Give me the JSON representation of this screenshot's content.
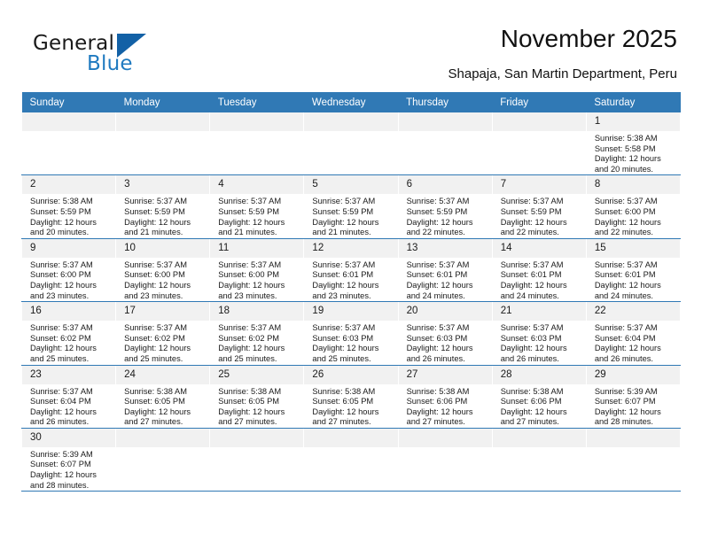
{
  "brand": {
    "name_part1": "General",
    "name_part2": "Blue",
    "triangle_color": "#1361a6",
    "blue_color": "#1f7ac0"
  },
  "header": {
    "title": "November 2025",
    "subtitle": "Shapaja, San Martin Department, Peru"
  },
  "theme": {
    "header_row_bg": "#3079b5",
    "header_row_text": "#ffffff",
    "daynum_bg": "#f1f1f1",
    "grid_line": "#3079b5"
  },
  "weekdays": [
    "Sunday",
    "Monday",
    "Tuesday",
    "Wednesday",
    "Thursday",
    "Friday",
    "Saturday"
  ],
  "weeks": [
    [
      {
        "day": "",
        "empty": true,
        "sunrise": "",
        "sunset": "",
        "daylight_line1": "",
        "daylight_line2": ""
      },
      {
        "day": "",
        "empty": true,
        "sunrise": "",
        "sunset": "",
        "daylight_line1": "",
        "daylight_line2": ""
      },
      {
        "day": "",
        "empty": true,
        "sunrise": "",
        "sunset": "",
        "daylight_line1": "",
        "daylight_line2": ""
      },
      {
        "day": "",
        "empty": true,
        "sunrise": "",
        "sunset": "",
        "daylight_line1": "",
        "daylight_line2": ""
      },
      {
        "day": "",
        "empty": true,
        "sunrise": "",
        "sunset": "",
        "daylight_line1": "",
        "daylight_line2": ""
      },
      {
        "day": "",
        "empty": true,
        "sunrise": "",
        "sunset": "",
        "daylight_line1": "",
        "daylight_line2": ""
      },
      {
        "day": "1",
        "empty": false,
        "sunrise": "Sunrise: 5:38 AM",
        "sunset": "Sunset: 5:58 PM",
        "daylight_line1": "Daylight: 12 hours",
        "daylight_line2": "and 20 minutes."
      }
    ],
    [
      {
        "day": "2",
        "empty": false,
        "sunrise": "Sunrise: 5:38 AM",
        "sunset": "Sunset: 5:59 PM",
        "daylight_line1": "Daylight: 12 hours",
        "daylight_line2": "and 20 minutes."
      },
      {
        "day": "3",
        "empty": false,
        "sunrise": "Sunrise: 5:37 AM",
        "sunset": "Sunset: 5:59 PM",
        "daylight_line1": "Daylight: 12 hours",
        "daylight_line2": "and 21 minutes."
      },
      {
        "day": "4",
        "empty": false,
        "sunrise": "Sunrise: 5:37 AM",
        "sunset": "Sunset: 5:59 PM",
        "daylight_line1": "Daylight: 12 hours",
        "daylight_line2": "and 21 minutes."
      },
      {
        "day": "5",
        "empty": false,
        "sunrise": "Sunrise: 5:37 AM",
        "sunset": "Sunset: 5:59 PM",
        "daylight_line1": "Daylight: 12 hours",
        "daylight_line2": "and 21 minutes."
      },
      {
        "day": "6",
        "empty": false,
        "sunrise": "Sunrise: 5:37 AM",
        "sunset": "Sunset: 5:59 PM",
        "daylight_line1": "Daylight: 12 hours",
        "daylight_line2": "and 22 minutes."
      },
      {
        "day": "7",
        "empty": false,
        "sunrise": "Sunrise: 5:37 AM",
        "sunset": "Sunset: 5:59 PM",
        "daylight_line1": "Daylight: 12 hours",
        "daylight_line2": "and 22 minutes."
      },
      {
        "day": "8",
        "empty": false,
        "sunrise": "Sunrise: 5:37 AM",
        "sunset": "Sunset: 6:00 PM",
        "daylight_line1": "Daylight: 12 hours",
        "daylight_line2": "and 22 minutes."
      }
    ],
    [
      {
        "day": "9",
        "empty": false,
        "sunrise": "Sunrise: 5:37 AM",
        "sunset": "Sunset: 6:00 PM",
        "daylight_line1": "Daylight: 12 hours",
        "daylight_line2": "and 23 minutes."
      },
      {
        "day": "10",
        "empty": false,
        "sunrise": "Sunrise: 5:37 AM",
        "sunset": "Sunset: 6:00 PM",
        "daylight_line1": "Daylight: 12 hours",
        "daylight_line2": "and 23 minutes."
      },
      {
        "day": "11",
        "empty": false,
        "sunrise": "Sunrise: 5:37 AM",
        "sunset": "Sunset: 6:00 PM",
        "daylight_line1": "Daylight: 12 hours",
        "daylight_line2": "and 23 minutes."
      },
      {
        "day": "12",
        "empty": false,
        "sunrise": "Sunrise: 5:37 AM",
        "sunset": "Sunset: 6:01 PM",
        "daylight_line1": "Daylight: 12 hours",
        "daylight_line2": "and 23 minutes."
      },
      {
        "day": "13",
        "empty": false,
        "sunrise": "Sunrise: 5:37 AM",
        "sunset": "Sunset: 6:01 PM",
        "daylight_line1": "Daylight: 12 hours",
        "daylight_line2": "and 24 minutes."
      },
      {
        "day": "14",
        "empty": false,
        "sunrise": "Sunrise: 5:37 AM",
        "sunset": "Sunset: 6:01 PM",
        "daylight_line1": "Daylight: 12 hours",
        "daylight_line2": "and 24 minutes."
      },
      {
        "day": "15",
        "empty": false,
        "sunrise": "Sunrise: 5:37 AM",
        "sunset": "Sunset: 6:01 PM",
        "daylight_line1": "Daylight: 12 hours",
        "daylight_line2": "and 24 minutes."
      }
    ],
    [
      {
        "day": "16",
        "empty": false,
        "sunrise": "Sunrise: 5:37 AM",
        "sunset": "Sunset: 6:02 PM",
        "daylight_line1": "Daylight: 12 hours",
        "daylight_line2": "and 25 minutes."
      },
      {
        "day": "17",
        "empty": false,
        "sunrise": "Sunrise: 5:37 AM",
        "sunset": "Sunset: 6:02 PM",
        "daylight_line1": "Daylight: 12 hours",
        "daylight_line2": "and 25 minutes."
      },
      {
        "day": "18",
        "empty": false,
        "sunrise": "Sunrise: 5:37 AM",
        "sunset": "Sunset: 6:02 PM",
        "daylight_line1": "Daylight: 12 hours",
        "daylight_line2": "and 25 minutes."
      },
      {
        "day": "19",
        "empty": false,
        "sunrise": "Sunrise: 5:37 AM",
        "sunset": "Sunset: 6:03 PM",
        "daylight_line1": "Daylight: 12 hours",
        "daylight_line2": "and 25 minutes."
      },
      {
        "day": "20",
        "empty": false,
        "sunrise": "Sunrise: 5:37 AM",
        "sunset": "Sunset: 6:03 PM",
        "daylight_line1": "Daylight: 12 hours",
        "daylight_line2": "and 26 minutes."
      },
      {
        "day": "21",
        "empty": false,
        "sunrise": "Sunrise: 5:37 AM",
        "sunset": "Sunset: 6:03 PM",
        "daylight_line1": "Daylight: 12 hours",
        "daylight_line2": "and 26 minutes."
      },
      {
        "day": "22",
        "empty": false,
        "sunrise": "Sunrise: 5:37 AM",
        "sunset": "Sunset: 6:04 PM",
        "daylight_line1": "Daylight: 12 hours",
        "daylight_line2": "and 26 minutes."
      }
    ],
    [
      {
        "day": "23",
        "empty": false,
        "sunrise": "Sunrise: 5:37 AM",
        "sunset": "Sunset: 6:04 PM",
        "daylight_line1": "Daylight: 12 hours",
        "daylight_line2": "and 26 minutes."
      },
      {
        "day": "24",
        "empty": false,
        "sunrise": "Sunrise: 5:38 AM",
        "sunset": "Sunset: 6:05 PM",
        "daylight_line1": "Daylight: 12 hours",
        "daylight_line2": "and 27 minutes."
      },
      {
        "day": "25",
        "empty": false,
        "sunrise": "Sunrise: 5:38 AM",
        "sunset": "Sunset: 6:05 PM",
        "daylight_line1": "Daylight: 12 hours",
        "daylight_line2": "and 27 minutes."
      },
      {
        "day": "26",
        "empty": false,
        "sunrise": "Sunrise: 5:38 AM",
        "sunset": "Sunset: 6:05 PM",
        "daylight_line1": "Daylight: 12 hours",
        "daylight_line2": "and 27 minutes."
      },
      {
        "day": "27",
        "empty": false,
        "sunrise": "Sunrise: 5:38 AM",
        "sunset": "Sunset: 6:06 PM",
        "daylight_line1": "Daylight: 12 hours",
        "daylight_line2": "and 27 minutes."
      },
      {
        "day": "28",
        "empty": false,
        "sunrise": "Sunrise: 5:38 AM",
        "sunset": "Sunset: 6:06 PM",
        "daylight_line1": "Daylight: 12 hours",
        "daylight_line2": "and 27 minutes."
      },
      {
        "day": "29",
        "empty": false,
        "sunrise": "Sunrise: 5:39 AM",
        "sunset": "Sunset: 6:07 PM",
        "daylight_line1": "Daylight: 12 hours",
        "daylight_line2": "and 28 minutes."
      }
    ],
    [
      {
        "day": "30",
        "empty": false,
        "sunrise": "Sunrise: 5:39 AM",
        "sunset": "Sunset: 6:07 PM",
        "daylight_line1": "Daylight: 12 hours",
        "daylight_line2": "and 28 minutes."
      },
      {
        "day": "",
        "empty": true,
        "sunrise": "",
        "sunset": "",
        "daylight_line1": "",
        "daylight_line2": ""
      },
      {
        "day": "",
        "empty": true,
        "sunrise": "",
        "sunset": "",
        "daylight_line1": "",
        "daylight_line2": ""
      },
      {
        "day": "",
        "empty": true,
        "sunrise": "",
        "sunset": "",
        "daylight_line1": "",
        "daylight_line2": ""
      },
      {
        "day": "",
        "empty": true,
        "sunrise": "",
        "sunset": "",
        "daylight_line1": "",
        "daylight_line2": ""
      },
      {
        "day": "",
        "empty": true,
        "sunrise": "",
        "sunset": "",
        "daylight_line1": "",
        "daylight_line2": ""
      },
      {
        "day": "",
        "empty": true,
        "sunrise": "",
        "sunset": "",
        "daylight_line1": "",
        "daylight_line2": ""
      }
    ]
  ]
}
